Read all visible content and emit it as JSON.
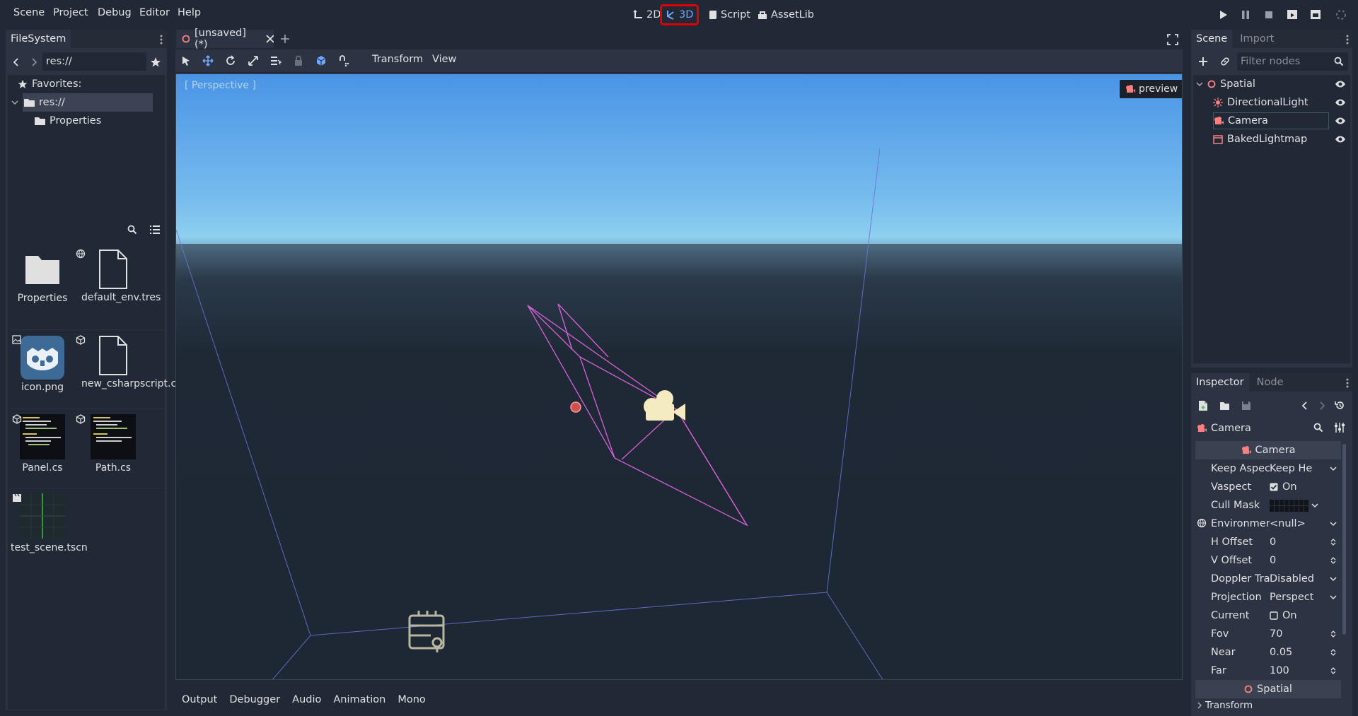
{
  "menu": [
    "Scene",
    "Project",
    "Debug",
    "Editor",
    "Help"
  ],
  "modes": {
    "two_d": "2D",
    "three_d": "3D",
    "script": "Script",
    "assetlib": "AssetLib"
  },
  "filesystem": {
    "tab": "FileSystem",
    "path": "res://",
    "favorites": "Favorites:",
    "root": "res://",
    "folder": "Properties",
    "files": [
      {
        "name": "Properties",
        "kind": "folder"
      },
      {
        "name": "default_env.tres",
        "kind": "file"
      },
      {
        "name": "icon.png",
        "kind": "image"
      },
      {
        "name": "new_csharpscript.cs",
        "kind": "file"
      },
      {
        "name": "Panel.cs",
        "kind": "script"
      },
      {
        "name": "Path.cs",
        "kind": "script"
      },
      {
        "name": "test_scene.tscn",
        "kind": "scene"
      }
    ]
  },
  "editor": {
    "tab": "[unsaved](*)",
    "menus": {
      "transform": "Transform",
      "view": "View"
    },
    "viewport_label": "[ Perspective ]",
    "preview": "preview"
  },
  "scene": {
    "tabs": {
      "scene": "Scene",
      "import": "Import"
    },
    "filter_placeholder": "Filter nodes",
    "nodes": [
      {
        "name": "Spatial",
        "icon": "spatial-icon"
      },
      {
        "name": "DirectionalLight",
        "icon": "light-icon"
      },
      {
        "name": "Camera",
        "icon": "camera-icon"
      },
      {
        "name": "BakedLightmap",
        "icon": "lightmap-icon"
      }
    ]
  },
  "inspector": {
    "tabs": {
      "inspector": "Inspector",
      "node": "Node"
    },
    "object": "Camera",
    "section": "Camera",
    "props": [
      {
        "k": "Keep Aspect",
        "v": "Keep He",
        "ctl": "dropdown"
      },
      {
        "k": "Vaspect",
        "v": "On",
        "ctl": "check-on"
      },
      {
        "k": "Cull Mask",
        "v": "",
        "ctl": "mask"
      },
      {
        "k": "Environmen",
        "v": "<null>",
        "ctl": "dropdown"
      },
      {
        "k": "H Offset",
        "v": "0",
        "ctl": "spin"
      },
      {
        "k": "V Offset",
        "v": "0",
        "ctl": "spin"
      },
      {
        "k": "Doppler Tracki",
        "v": "Disabled",
        "ctl": "dropdown"
      },
      {
        "k": "Projection",
        "v": "Perspect",
        "ctl": "dropdown"
      },
      {
        "k": "Current",
        "v": "On",
        "ctl": "check-off"
      },
      {
        "k": "Fov",
        "v": "70",
        "ctl": "spin"
      },
      {
        "k": "Near",
        "v": "0.05",
        "ctl": "spin"
      },
      {
        "k": "Far",
        "v": "100",
        "ctl": "spin"
      }
    ],
    "section2": "Spatial",
    "section3": "Transform"
  },
  "bottom": [
    "Output",
    "Debugger",
    "Audio",
    "Animation",
    "Mono"
  ],
  "colors": {
    "accent": "#6fa8ff",
    "highlight": "#e30000",
    "bg": "#222936",
    "panel": "#2c3343",
    "camera": "#fc7f7f",
    "gizmo": "#d860d8"
  }
}
